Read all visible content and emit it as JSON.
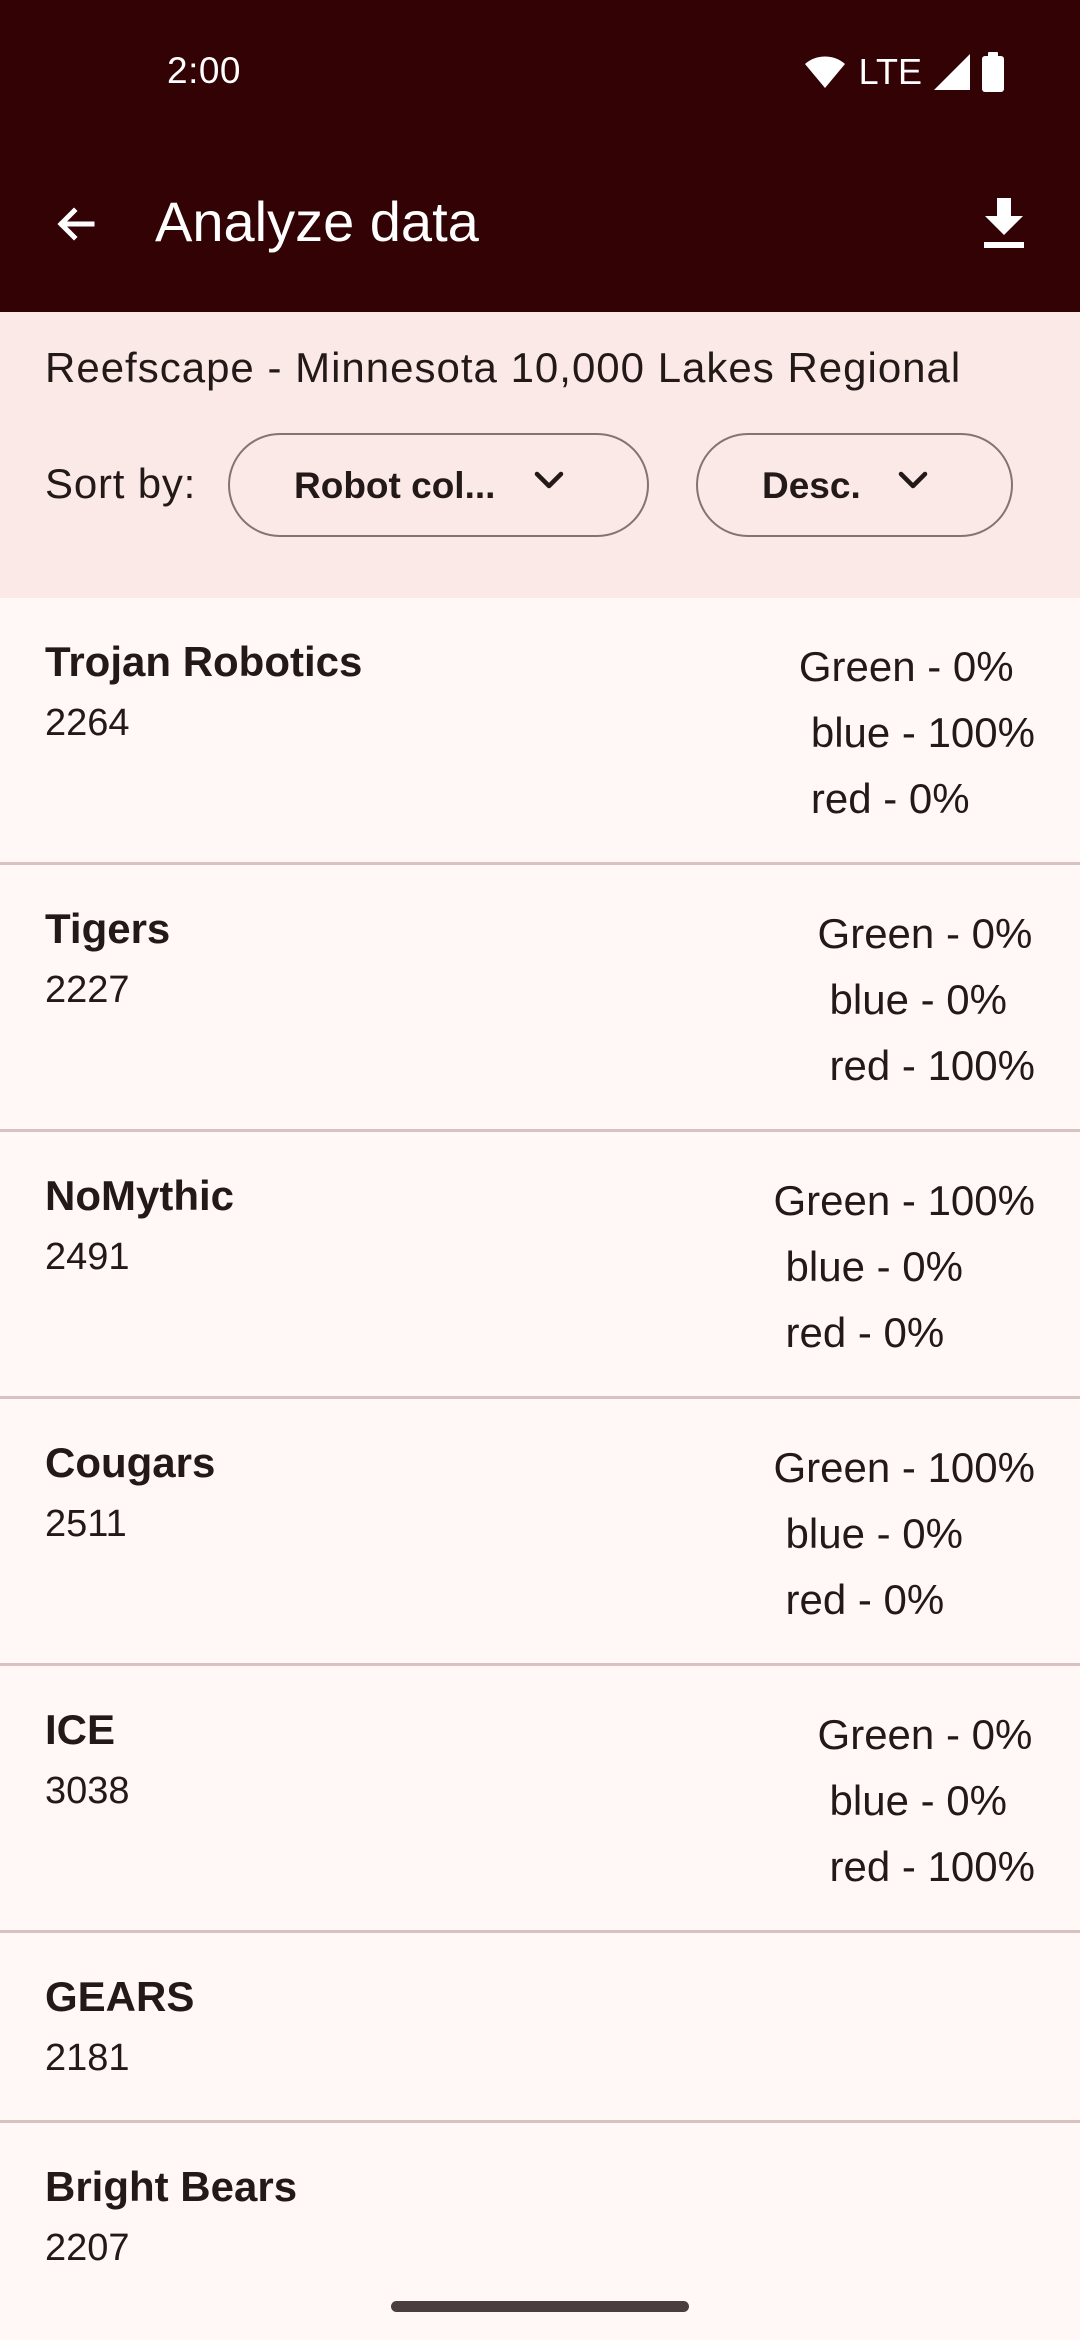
{
  "status_bar": {
    "time": "2:00",
    "network": "LTE",
    "icons": [
      "wifi-icon",
      "signal-icon",
      "battery-icon"
    ]
  },
  "app_bar": {
    "title": "Analyze data",
    "back_icon": "arrow-back-icon",
    "action_icon": "download-icon"
  },
  "filter": {
    "event": "Reefscape - Minnesota 10,000 Lakes Regional",
    "sort_label": "Sort by:",
    "sort_value": "Robot col...",
    "order_value": "Desc."
  },
  "teams": [
    {
      "name": "Trojan Robotics",
      "number": "2264",
      "green": "Green - 0%",
      "blue": "blue - 100%",
      "red": "red - 0%"
    },
    {
      "name": "Tigers",
      "number": "2227",
      "green": "Green - 0%",
      "blue": "blue - 0%",
      "red": "red - 100%"
    },
    {
      "name": "NoMythic",
      "number": "2491",
      "green": "Green - 100%",
      "blue": "blue - 0%",
      "red": "red - 0%"
    },
    {
      "name": "Cougars",
      "number": "2511",
      "green": "Green - 100%",
      "blue": "blue - 0%",
      "red": "red - 0%"
    },
    {
      "name": "ICE",
      "number": "3038",
      "green": "Green - 0%",
      "blue": "blue - 0%",
      "red": "red - 100%"
    },
    {
      "name": "GEARS",
      "number": "2181"
    },
    {
      "name": "Bright Bears",
      "number": "2207"
    }
  ],
  "colors": {
    "app_bar": "#330204",
    "filter_panel": "#fbe9e7",
    "background": "#fff8f6",
    "divider": "#d8c2bf"
  }
}
